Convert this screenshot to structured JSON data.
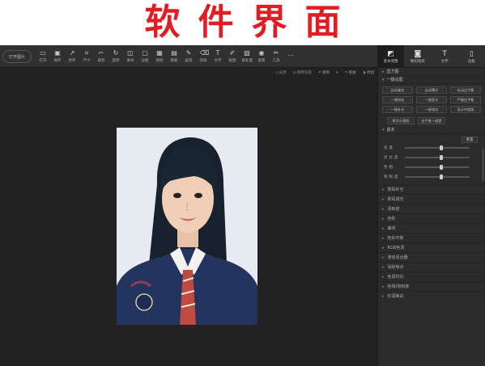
{
  "banner": {
    "title": "软件界面",
    "color": "#e11c23"
  },
  "toolbar": {
    "open_label": "打开图片",
    "tools": [
      {
        "icon": "folder-icon",
        "glyph": "▭",
        "label": "打开"
      },
      {
        "icon": "save-icon",
        "glyph": "▣",
        "label": "保存"
      },
      {
        "icon": "share-icon",
        "glyph": "↗",
        "label": "另存"
      },
      {
        "icon": "size-icon",
        "glyph": "⌗",
        "label": "尺寸"
      },
      {
        "icon": "crop-icon",
        "glyph": "⌐",
        "label": "裁剪"
      },
      {
        "icon": "rotate-icon",
        "glyph": "↻",
        "label": "旋转"
      },
      {
        "icon": "material-icon",
        "glyph": "◫",
        "label": "素材"
      },
      {
        "icon": "border-icon",
        "glyph": "▢",
        "label": "边框"
      },
      {
        "icon": "puzzle-icon",
        "glyph": "▦",
        "label": "拼图"
      },
      {
        "icon": "template-icon",
        "glyph": "▤",
        "label": "模板"
      },
      {
        "icon": "brush-icon",
        "glyph": "✎",
        "label": "画笔"
      },
      {
        "icon": "erase-icon",
        "glyph": "⌫",
        "label": "涂抹"
      },
      {
        "icon": "text-icon",
        "glyph": "T",
        "label": "文字"
      },
      {
        "icon": "pick-icon",
        "glyph": "✐",
        "label": "抠图"
      },
      {
        "icon": "batch-icon",
        "glyph": "▧",
        "label": "批处理"
      },
      {
        "icon": "view-icon",
        "glyph": "◉",
        "label": "查看"
      },
      {
        "icon": "tools-icon",
        "glyph": "✂",
        "label": "工具"
      },
      {
        "icon": "more-icon",
        "glyph": "⋯",
        "label": ""
      }
    ]
  },
  "right_tabs": [
    {
      "icon": "adjust-tab-icon",
      "glyph": "◩",
      "label": "基本调整",
      "active": true
    },
    {
      "icon": "camera-tab-icon",
      "glyph": "◙",
      "label": "数码暗房",
      "active": false
    },
    {
      "icon": "text-tab-icon",
      "glyph": "T",
      "label": "文字",
      "active": false
    },
    {
      "icon": "doc-tab-icon",
      "glyph": "▯",
      "label": "边框",
      "active": false
    }
  ],
  "canvas_bar": [
    "◁ 分享",
    "◎ 保存历史",
    "↶ 撤销",
    "▾",
    "↷ 重做",
    "◑ 原图"
  ],
  "panel": {
    "section1": "直方图",
    "section2": "一键设置",
    "oneclick_buttons": [
      "自动美化",
      "自动曝光",
      "自动白平衡",
      "一键锐化",
      "一键柔光",
      "严重白平衡",
      "一键补光",
      "一键减光",
      "显示中国版"
    ],
    "extra_buttons": [
      "数字示意图",
      "白平衡一键提"
    ],
    "basic_title": "基本",
    "reset_label": "重置",
    "sliders": [
      {
        "label": "亮度",
        "level": 0.57
      },
      {
        "label": "对比度",
        "level": 0.57
      },
      {
        "label": "色相",
        "level": 0.57
      },
      {
        "label": "饱和度",
        "level": 0.57
      }
    ],
    "collapsed": [
      "数码补光",
      "数码减光",
      "清晰度",
      "色阶",
      "曲线",
      "色彩平衡",
      "RGB色调",
      "通道混合器",
      "消除噪点",
      "色调均化",
      "色相/饱和度",
      "红润美白"
    ]
  }
}
